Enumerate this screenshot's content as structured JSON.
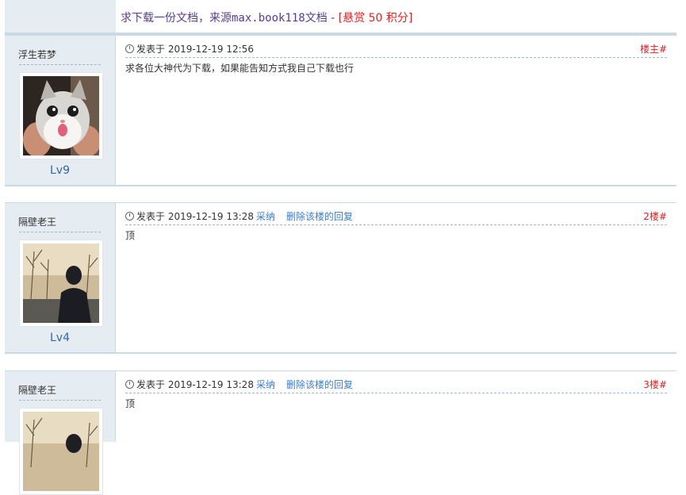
{
  "thread": {
    "title_main": "求下载一份文档，来源",
    "title_mono": "max.book118",
    "title_tail": "文档 - ",
    "reward": "[悬赏 50 积分]"
  },
  "posts": [
    {
      "user": "浮生若梦",
      "level": "Lv9",
      "posted_label": "发表于 2019-12-19 12:56",
      "floor": "楼主#",
      "content": "求各位大神代为下载，如果能告知方式我自己下载也行"
    },
    {
      "user": "隔壁老王",
      "level": "Lv4",
      "posted_label": "发表于 2019-12-19 13:28",
      "accept": "采纳",
      "delete": "删除该楼的回复",
      "floor": "2楼#",
      "content": "顶"
    },
    {
      "user": "隔壁老王",
      "posted_label": "发表于 2019-12-19 13:28",
      "accept": "采纳",
      "delete": "删除该楼的回复",
      "floor": "3楼#",
      "content": "顶"
    }
  ]
}
